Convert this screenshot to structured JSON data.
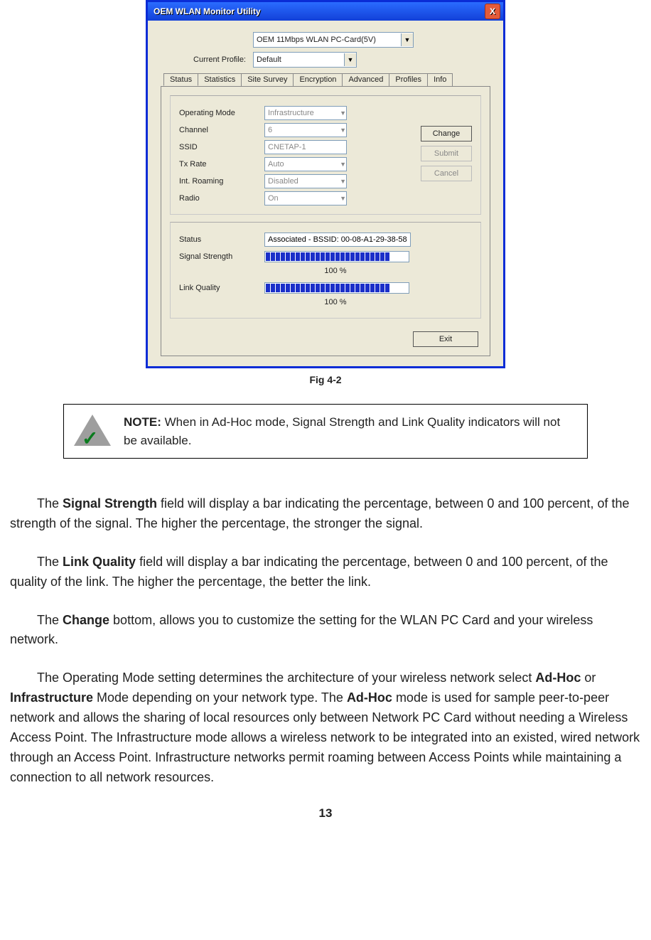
{
  "dialog": {
    "title": "OEM  WLAN  Monitor  Utility",
    "close_glyph": "X",
    "card_combo": "OEM 11Mbps WLAN PC-Card(5V)",
    "profile_label": "Current Profile:",
    "profile_value": "Default",
    "tabs": [
      "Status",
      "Statistics",
      "Site Survey",
      "Encryption",
      "Advanced",
      "Profiles",
      "Info"
    ],
    "fields": {
      "operating_mode": {
        "label": "Operating Mode",
        "value": "Infrastructure"
      },
      "channel": {
        "label": "Channel",
        "value": "6"
      },
      "ssid": {
        "label": "SSID",
        "value": "CNETAP-1"
      },
      "tx_rate": {
        "label": "Tx Rate",
        "value": "Auto"
      },
      "int_roaming": {
        "label": "Int. Roaming",
        "value": "Disabled"
      },
      "radio": {
        "label": "Radio",
        "value": "On"
      }
    },
    "buttons": {
      "change": "Change",
      "submit": "Submit",
      "cancel": "Cancel",
      "exit": "Exit"
    },
    "status": {
      "label": "Status",
      "value": "Associated - BSSID: 00-08-A1-29-38-58",
      "signal_label": "Signal Strength",
      "signal_pct": "100 %",
      "link_label": "Link Quality",
      "link_pct": "100 %"
    }
  },
  "fig_caption": "Fig 4-2",
  "note": {
    "bold": "NOTE:",
    "text": " When in Ad-Hoc mode, Signal Strength and Link Quality indicators will not be available."
  },
  "paras": {
    "p1a": "The ",
    "p1b": "Signal Strength",
    "p1c": " field will display a bar indicating the percentage, between 0 and 100 percent, of the strength of the signal. The higher the percentage, the stronger the signal.",
    "p2a": "The ",
    "p2b": "Link Quality",
    "p2c": " field will display a bar indicating the percentage, between 0 and 100 percent, of the quality of the link. The higher the percentage, the better the link.",
    "p3a": "The ",
    "p3b": "Change",
    "p3c": " bottom, allows you to customize the setting for the WLAN PC Card and your wireless network.",
    "p4a": "The Operating Mode setting determines the architecture of your wireless network select ",
    "p4b": "Ad-Hoc",
    "p4c": " or ",
    "p4d": "Infrastructure",
    "p4e": " Mode depending on your network type. The ",
    "p4f": "Ad-Hoc",
    "p4g": " mode is used for sample peer-to-peer network and allows the sharing of local resources only between Network PC Card without needing a Wireless Access Point. The Infrastructure mode allows a wireless network to be integrated into an existed, wired network through an Access Point. Infrastructure networks permit roaming between Access Points while maintaining a connection to all network resources."
  },
  "page_number": "13"
}
